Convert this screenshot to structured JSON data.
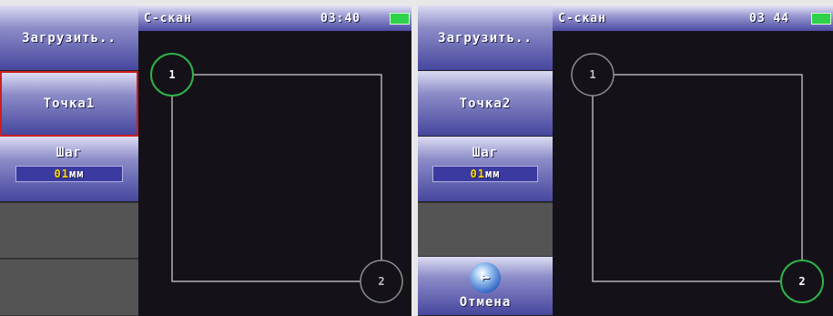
{
  "screens": [
    {
      "sidebar": {
        "load_label": "Загрузить..",
        "point_label": "Точка1",
        "step_label": "Шаг",
        "step_value_hl": "01",
        "step_value_unit": "мм"
      },
      "header": {
        "title": "С-скан",
        "time": "03:40"
      },
      "points": {
        "p1": "1",
        "p2": "2"
      },
      "active_point": "1",
      "colors": {
        "active_ring": "#2fb24a",
        "inactive_ring": "#8a8a8a"
      }
    },
    {
      "sidebar": {
        "load_label": "Загрузить..",
        "point_label": "Точка2",
        "step_label": "Шаг",
        "step_value_hl": "01",
        "step_value_unit": "мм",
        "cancel_label": "Отмена",
        "cancel_icon": "back-arrow-icon"
      },
      "header": {
        "title": "С-скан",
        "time": "03 44"
      },
      "points": {
        "p1": "1",
        "p2": "2"
      },
      "active_point": "2",
      "colors": {
        "active_ring": "#2fb24a",
        "inactive_ring": "#8a8a8a"
      }
    }
  ]
}
